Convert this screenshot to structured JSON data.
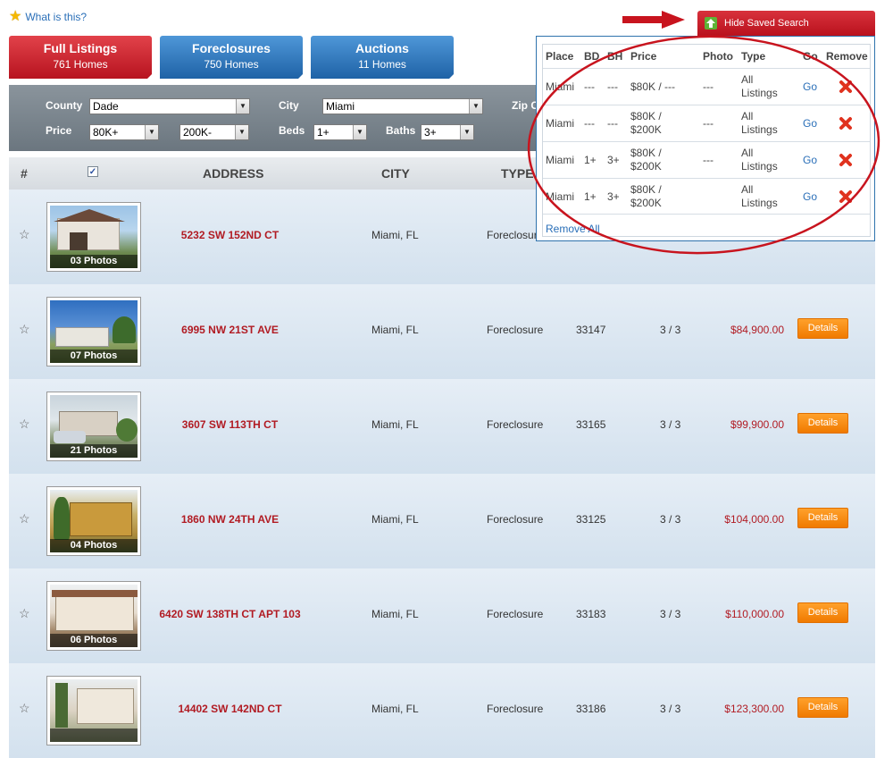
{
  "help_link": "What is this?",
  "hide_saved_search": "Hide Saved Search",
  "tabs": [
    {
      "title": "Full Listings",
      "count": "761 Homes"
    },
    {
      "title": "Foreclosures",
      "count": "750 Homes"
    },
    {
      "title": "Auctions",
      "count": "11 Homes"
    }
  ],
  "search": {
    "county_label": "County",
    "county_value": "Dade",
    "city_label": "City",
    "city_value": "Miami",
    "zip_label": "Zip C",
    "price_label": "Price",
    "price_min": "80K+",
    "price_max": "200K-",
    "beds_label": "Beds",
    "beds_value": "1+",
    "baths_label": "Baths",
    "baths_value": "3+"
  },
  "table_headers": {
    "num": "#",
    "address": "ADDRESS",
    "city": "CITY",
    "type": "TYPE"
  },
  "listings": [
    {
      "photos": "03 Photos",
      "address": "5232 SW 152ND CT",
      "city": "Miami, FL",
      "type": "Foreclosure",
      "zip": "",
      "bdbh": "",
      "price": ""
    },
    {
      "photos": "07 Photos",
      "address": "6995 NW 21ST AVE",
      "city": "Miami, FL",
      "type": "Foreclosure",
      "zip": "33147",
      "bdbh": "3 / 3",
      "price": "$84,900.00",
      "details": "Details"
    },
    {
      "photos": "21 Photos",
      "address": "3607 SW 113TH CT",
      "city": "Miami, FL",
      "type": "Foreclosure",
      "zip": "33165",
      "bdbh": "3 / 3",
      "price": "$99,900.00",
      "details": "Details"
    },
    {
      "photos": "04 Photos",
      "address": "1860 NW 24TH AVE",
      "city": "Miami, FL",
      "type": "Foreclosure",
      "zip": "33125",
      "bdbh": "3 / 3",
      "price": "$104,000.00",
      "details": "Details"
    },
    {
      "photos": "06 Photos",
      "address": "6420 SW 138TH CT APT 103",
      "city": "Miami, FL",
      "type": "Foreclosure",
      "zip": "33183",
      "bdbh": "3 / 3",
      "price": "$110,000.00",
      "details": "Details"
    },
    {
      "photos": "",
      "address": "14402 SW 142ND CT",
      "city": "Miami, FL",
      "type": "Foreclosure",
      "zip": "33186",
      "bdbh": "3 / 3",
      "price": "$123,300.00",
      "details": "Details"
    }
  ],
  "saved_search": {
    "headers": {
      "place": "Place",
      "bd": "BD",
      "bh": "BH",
      "price": "Price",
      "photo": "Photo",
      "type": "Type",
      "go": "Go",
      "remove": "Remove"
    },
    "rows": [
      {
        "place": "Miami",
        "bd": "---",
        "bh": "---",
        "price_line1": "$80K / ---",
        "price_line2": "",
        "photo": "---",
        "type_line1": "All",
        "type_line2": "Listings",
        "go": "Go"
      },
      {
        "place": "Miami",
        "bd": "---",
        "bh": "---",
        "price_line1": "$80K /",
        "price_line2": "$200K",
        "photo": "---",
        "type_line1": "All",
        "type_line2": "Listings",
        "go": "Go"
      },
      {
        "place": "Miami",
        "bd": "1+",
        "bh": "3+",
        "price_line1": "$80K /",
        "price_line2": "$200K",
        "photo": "---",
        "type_line1": "All",
        "type_line2": "Listings",
        "go": "Go"
      },
      {
        "place": "Miami",
        "bd": "1+",
        "bh": "3+",
        "price_line1": "$80K /",
        "price_line2": "$200K",
        "photo": "",
        "type_line1": "All",
        "type_line2": "Listings",
        "go": "Go"
      }
    ],
    "remove_all": "Remove All"
  },
  "colors": {
    "accent_red": "#b11b23",
    "tab_blue": "#1f62a6",
    "details_orange": "#f07a00",
    "link_blue": "#2a6fb8",
    "highlight_red": "#c8141e"
  }
}
